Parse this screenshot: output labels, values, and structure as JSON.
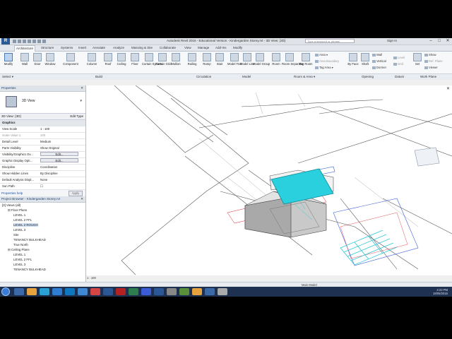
{
  "window": {
    "title": "Autodesk Revit 2016 - Educational Version - Kindergarden Storey.rvt - 3D View: {3D}",
    "search_placeholder": "Type a keyword or phrase",
    "sign_in": "Sign In",
    "logo": "R",
    "min": "–",
    "max": "□",
    "close": "✕"
  },
  "tabs": [
    "Architecture",
    "Structure",
    "Systems",
    "Insert",
    "Annotate",
    "Analyze",
    "Massing & Site",
    "Collaborate",
    "View",
    "Manage",
    "Add-Ins",
    "Modify"
  ],
  "ribbon": {
    "modify": "Modify",
    "build_buttons": [
      "Wall",
      "Door",
      "Window",
      "Component",
      "Column",
      "Roof",
      "Ceiling",
      "Floor",
      "Curtain System",
      "Curtain Grid",
      "Mullion"
    ],
    "circulation_buttons": [
      "Railing",
      "Ramp",
      "Stair"
    ],
    "model_buttons": [
      "Model Text",
      "Model Line",
      "Model Group"
    ],
    "room_buttons": [
      "Room",
      "Room Separator",
      "Tag Room"
    ],
    "area_small": [
      "Area ▾",
      "Area Boundary",
      "Tag Area ▾"
    ],
    "opening_buttons": [
      "By Face",
      "Shaft"
    ],
    "opening_small": [
      "Wall",
      "Vertical",
      "Dormer"
    ],
    "datum_small": [
      "Level",
      "Grid"
    ],
    "workplane_buttons": [
      "Set"
    ],
    "workplane_small": [
      "Show",
      "Ref. Plane",
      "Viewer"
    ],
    "panels": [
      "Select ▾",
      "Build",
      "Circulation",
      "Model",
      "Room & Area ▾",
      "Opening",
      "Datum",
      "Work Plane"
    ]
  },
  "select_bar": "Select ▾",
  "properties": {
    "header": "Properties",
    "type_name": "3D View",
    "instance_label": "3D View: {3D}",
    "edit_type": "Edit Type",
    "rows": [
      {
        "k": "Graphics",
        "v": "",
        "group": true
      },
      {
        "k": "View Scale",
        "v": "1 : 100"
      },
      {
        "k": "Scale Value  1:",
        "v": "100",
        "disabled": true
      },
      {
        "k": "Detail Level",
        "v": "Medium"
      },
      {
        "k": "Parts Visibility",
        "v": "Show Original"
      },
      {
        "k": "Visibility/Graphics Ov...",
        "v": "Edit...",
        "btn": true
      },
      {
        "k": "Graphic Display Opti...",
        "v": "Edit...",
        "btn": true
      },
      {
        "k": "Discipline",
        "v": "Coordination"
      },
      {
        "k": "Show Hidden Lines",
        "v": "By Discipline"
      },
      {
        "k": "Default Analysis Displ...",
        "v": "None"
      },
      {
        "k": "Sun Path",
        "v": "☐"
      }
    ],
    "help": "Properties help",
    "apply": "Apply"
  },
  "browser": {
    "header": "Project Browser - Kindergarden Storey.rvt",
    "items": [
      {
        "t": "[0] Views (all)",
        "lvl": 0
      },
      {
        "t": "⊟ Floor Plans",
        "lvl": 1
      },
      {
        "t": "LEVEL 1",
        "lvl": 2
      },
      {
        "t": "LEVEL 2 FFL",
        "lvl": 2
      },
      {
        "t": "LEVEL 2 ROUGH",
        "lvl": 2,
        "hl": true
      },
      {
        "t": "LEVEL 3",
        "lvl": 2
      },
      {
        "t": "Site",
        "lvl": 2
      },
      {
        "t": "TENANCY BULKHEAD",
        "lvl": 2
      },
      {
        "t": "True North",
        "lvl": 2
      },
      {
        "t": "⊟ Ceiling Plans",
        "lvl": 1
      },
      {
        "t": "LEVEL 1",
        "lvl": 2
      },
      {
        "t": "LEVEL 2 FFL",
        "lvl": 2
      },
      {
        "t": "LEVEL 3",
        "lvl": 2
      },
      {
        "t": "TENANCY BULKHEAD",
        "lvl": 2
      }
    ]
  },
  "view_controls": "1 : 100",
  "status": "DD7.dwg : Import Symbol : Location <Not Shared>",
  "status_model": "Main Model",
  "tray": {
    "time": "4:23 PM",
    "date": "18/05/2016"
  },
  "colors": {
    "accent": "#2bc7d9",
    "taskbar": "#1f3150",
    "ribbon": "#f7f8fa"
  }
}
